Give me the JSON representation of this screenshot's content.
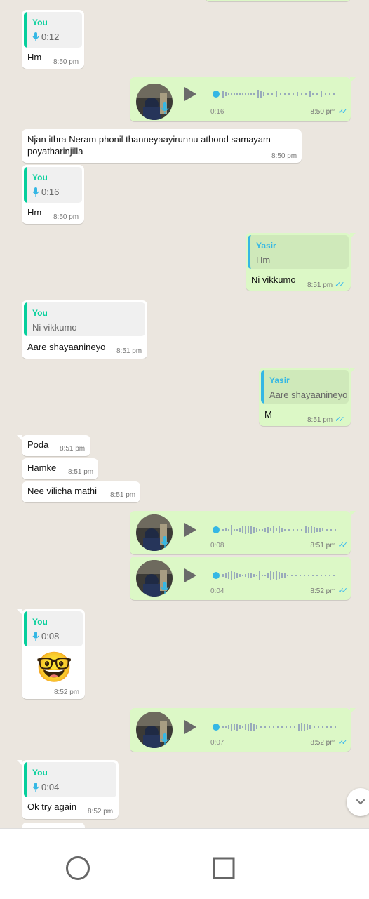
{
  "quote_you": "You",
  "quote_yasir": "Yasir",
  "messages": {
    "m1": {
      "quote_duration": "0:12",
      "text": "Hm",
      "time": "8:50 pm"
    },
    "m2": {
      "duration": "0:16",
      "time": "8:50 pm"
    },
    "m3": {
      "text_line1": "Njan ithra Neram phonil thanneyaayirunnu athond samayam",
      "text_line2": "poyatharinjilla",
      "time": "8:50 pm"
    },
    "m4": {
      "quote_duration": "0:16",
      "text": "Hm",
      "time": "8:50 pm"
    },
    "m5": {
      "quote_text": "Hm",
      "text": "Ni vikkumo",
      "time": "8:51 pm"
    },
    "m6": {
      "quote_text": "Ni vikkumo",
      "text": "Aare shayaanineyo",
      "time": "8:51 pm"
    },
    "m7": {
      "quote_text": "Aare shayaanineyo",
      "text": "M",
      "time": "8:51 pm"
    },
    "m8": {
      "text": "Poda",
      "time": "8:51 pm"
    },
    "m9": {
      "text": "Hamke",
      "time": "8:51 pm"
    },
    "m10": {
      "text": "Nee vilicha mathi",
      "time": "8:51 pm"
    },
    "m11": {
      "duration": "0:08",
      "time": "8:51 pm"
    },
    "m12": {
      "duration": "0:04",
      "time": "8:52 pm"
    },
    "m13": {
      "quote_duration": "0:08",
      "emoji": "🤓",
      "time": "8:52 pm"
    },
    "m14": {
      "duration": "0:07",
      "time": "8:52 pm"
    },
    "m15": {
      "quote_duration": "0:04",
      "text": "Ok try again",
      "time": "8:52 pm"
    }
  },
  "colors": {
    "incoming": "#ffffff",
    "outgoing": "#dcf8c6",
    "you_quote_bar": "#06cf9c",
    "yasir_quote_bar": "#35b7e4",
    "tick": "#34b7f1"
  },
  "icons": {
    "mic": "mic-icon",
    "play": "play-icon",
    "read_ticks": "double-check-icon",
    "scroll": "chevron-down-icon",
    "nav_home": "circle-icon",
    "nav_recent": "square-icon"
  }
}
